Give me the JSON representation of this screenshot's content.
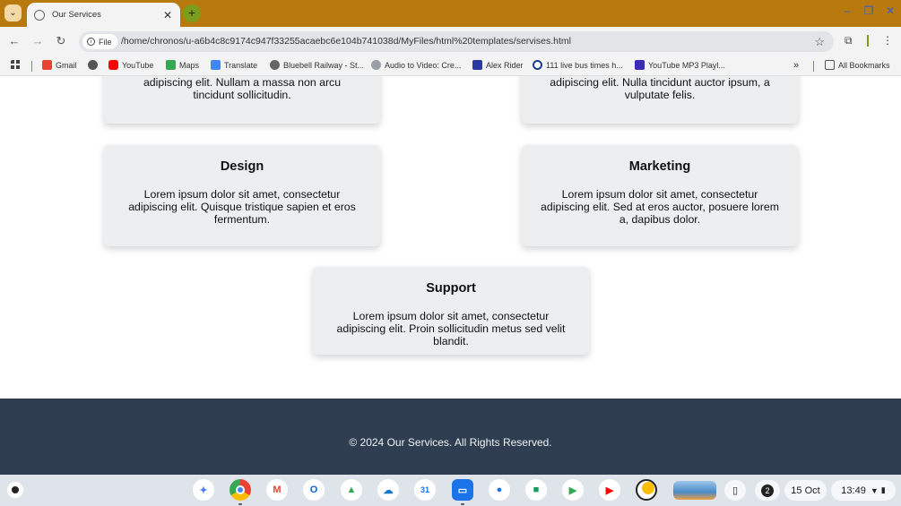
{
  "browser": {
    "tab_title": "Our Services",
    "url_chip": "File",
    "url": "/home/chronos/u-a6b4c8c9174c947f33255acaebc6e104b741038d/MyFiles/html%20templates/servises.html"
  },
  "bookmarks": {
    "items": [
      "Gmail",
      "",
      "YouTube",
      "Maps",
      "Translate",
      "Bluebell Railway - St...",
      "Audio to Video: Cre...",
      "Alex Rider",
      "111 live bus times h...",
      "YouTube MP3 Playl..."
    ],
    "overflow": "»",
    "all_label": "All Bookmarks"
  },
  "services": [
    {
      "title": "",
      "text": "Lorem ipsum dolor sit amet, consectetur adipiscing elit. Nullam a massa non arcu tincidunt sollicitudin."
    },
    {
      "title": "",
      "text": "Lorem ipsum dolor sit amet, consectetur adipiscing elit. Nulla tincidunt auctor ipsum, a vulputate felis."
    },
    {
      "title": "Design",
      "text": "Lorem ipsum dolor sit amet, consectetur adipiscing elit. Quisque tristique sapien et eros fermentum."
    },
    {
      "title": "Marketing",
      "text": "Lorem ipsum dolor sit amet, consectetur adipiscing elit. Sed at eros auctor, posuere lorem a, dapibus dolor."
    },
    {
      "title": "Support",
      "text": "Lorem ipsum dolor sit amet, consectetur adipiscing elit. Proin sollicitudin metus sed velit blandit."
    }
  ],
  "footer": {
    "text": "© 2024 Our Services. All Rights Reserved."
  },
  "shelf": {
    "apps": [
      "gemini-icon",
      "chrome-icon",
      "gmail-icon",
      "outlook-icon",
      "drive-icon",
      "onedrive-icon",
      "calendar-icon",
      "files-icon",
      "chat-icon",
      "meet-icon",
      "play-store-icon",
      "youtube-icon",
      "photos-icon"
    ],
    "notification_count": "2",
    "date": "15 Oct",
    "time": "13:49"
  },
  "colors": {
    "tabstrip": "#b8790f",
    "footer": "#2e3e50",
    "card": "#eceeef"
  }
}
